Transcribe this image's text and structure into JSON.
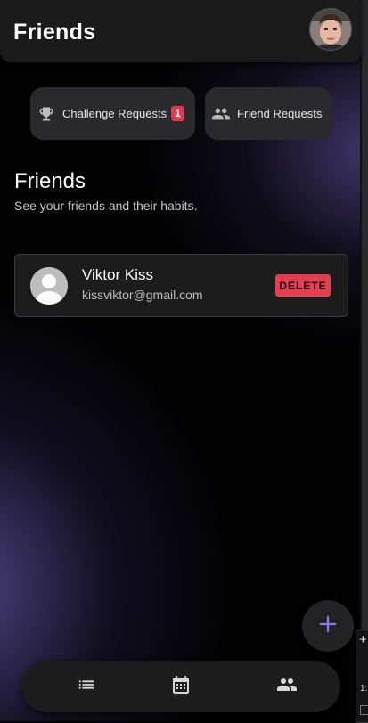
{
  "header": {
    "title": "Friends"
  },
  "top_buttons": {
    "challenge_label": "Challenge Requests",
    "challenge_badge": "1",
    "friend_requests_label": "Friend Requests"
  },
  "section": {
    "title": "Friends",
    "subtitle": "See your friends and their habits."
  },
  "friends": [
    {
      "name": "Viktor Kiss",
      "email": "kissviktor@gmail.com",
      "delete_label": "DELETE"
    }
  ],
  "side_panel": {
    "text": "1:"
  },
  "icons": {
    "challenge": "trophy-icon",
    "friend_requests": "people-icon",
    "fab": "plus-icon",
    "nav": [
      "list-icon",
      "calendar-icon",
      "people-icon"
    ]
  },
  "colors": {
    "accent": "#8b7ff0",
    "danger": "#e53e52",
    "surface": "#1c1c1d"
  }
}
